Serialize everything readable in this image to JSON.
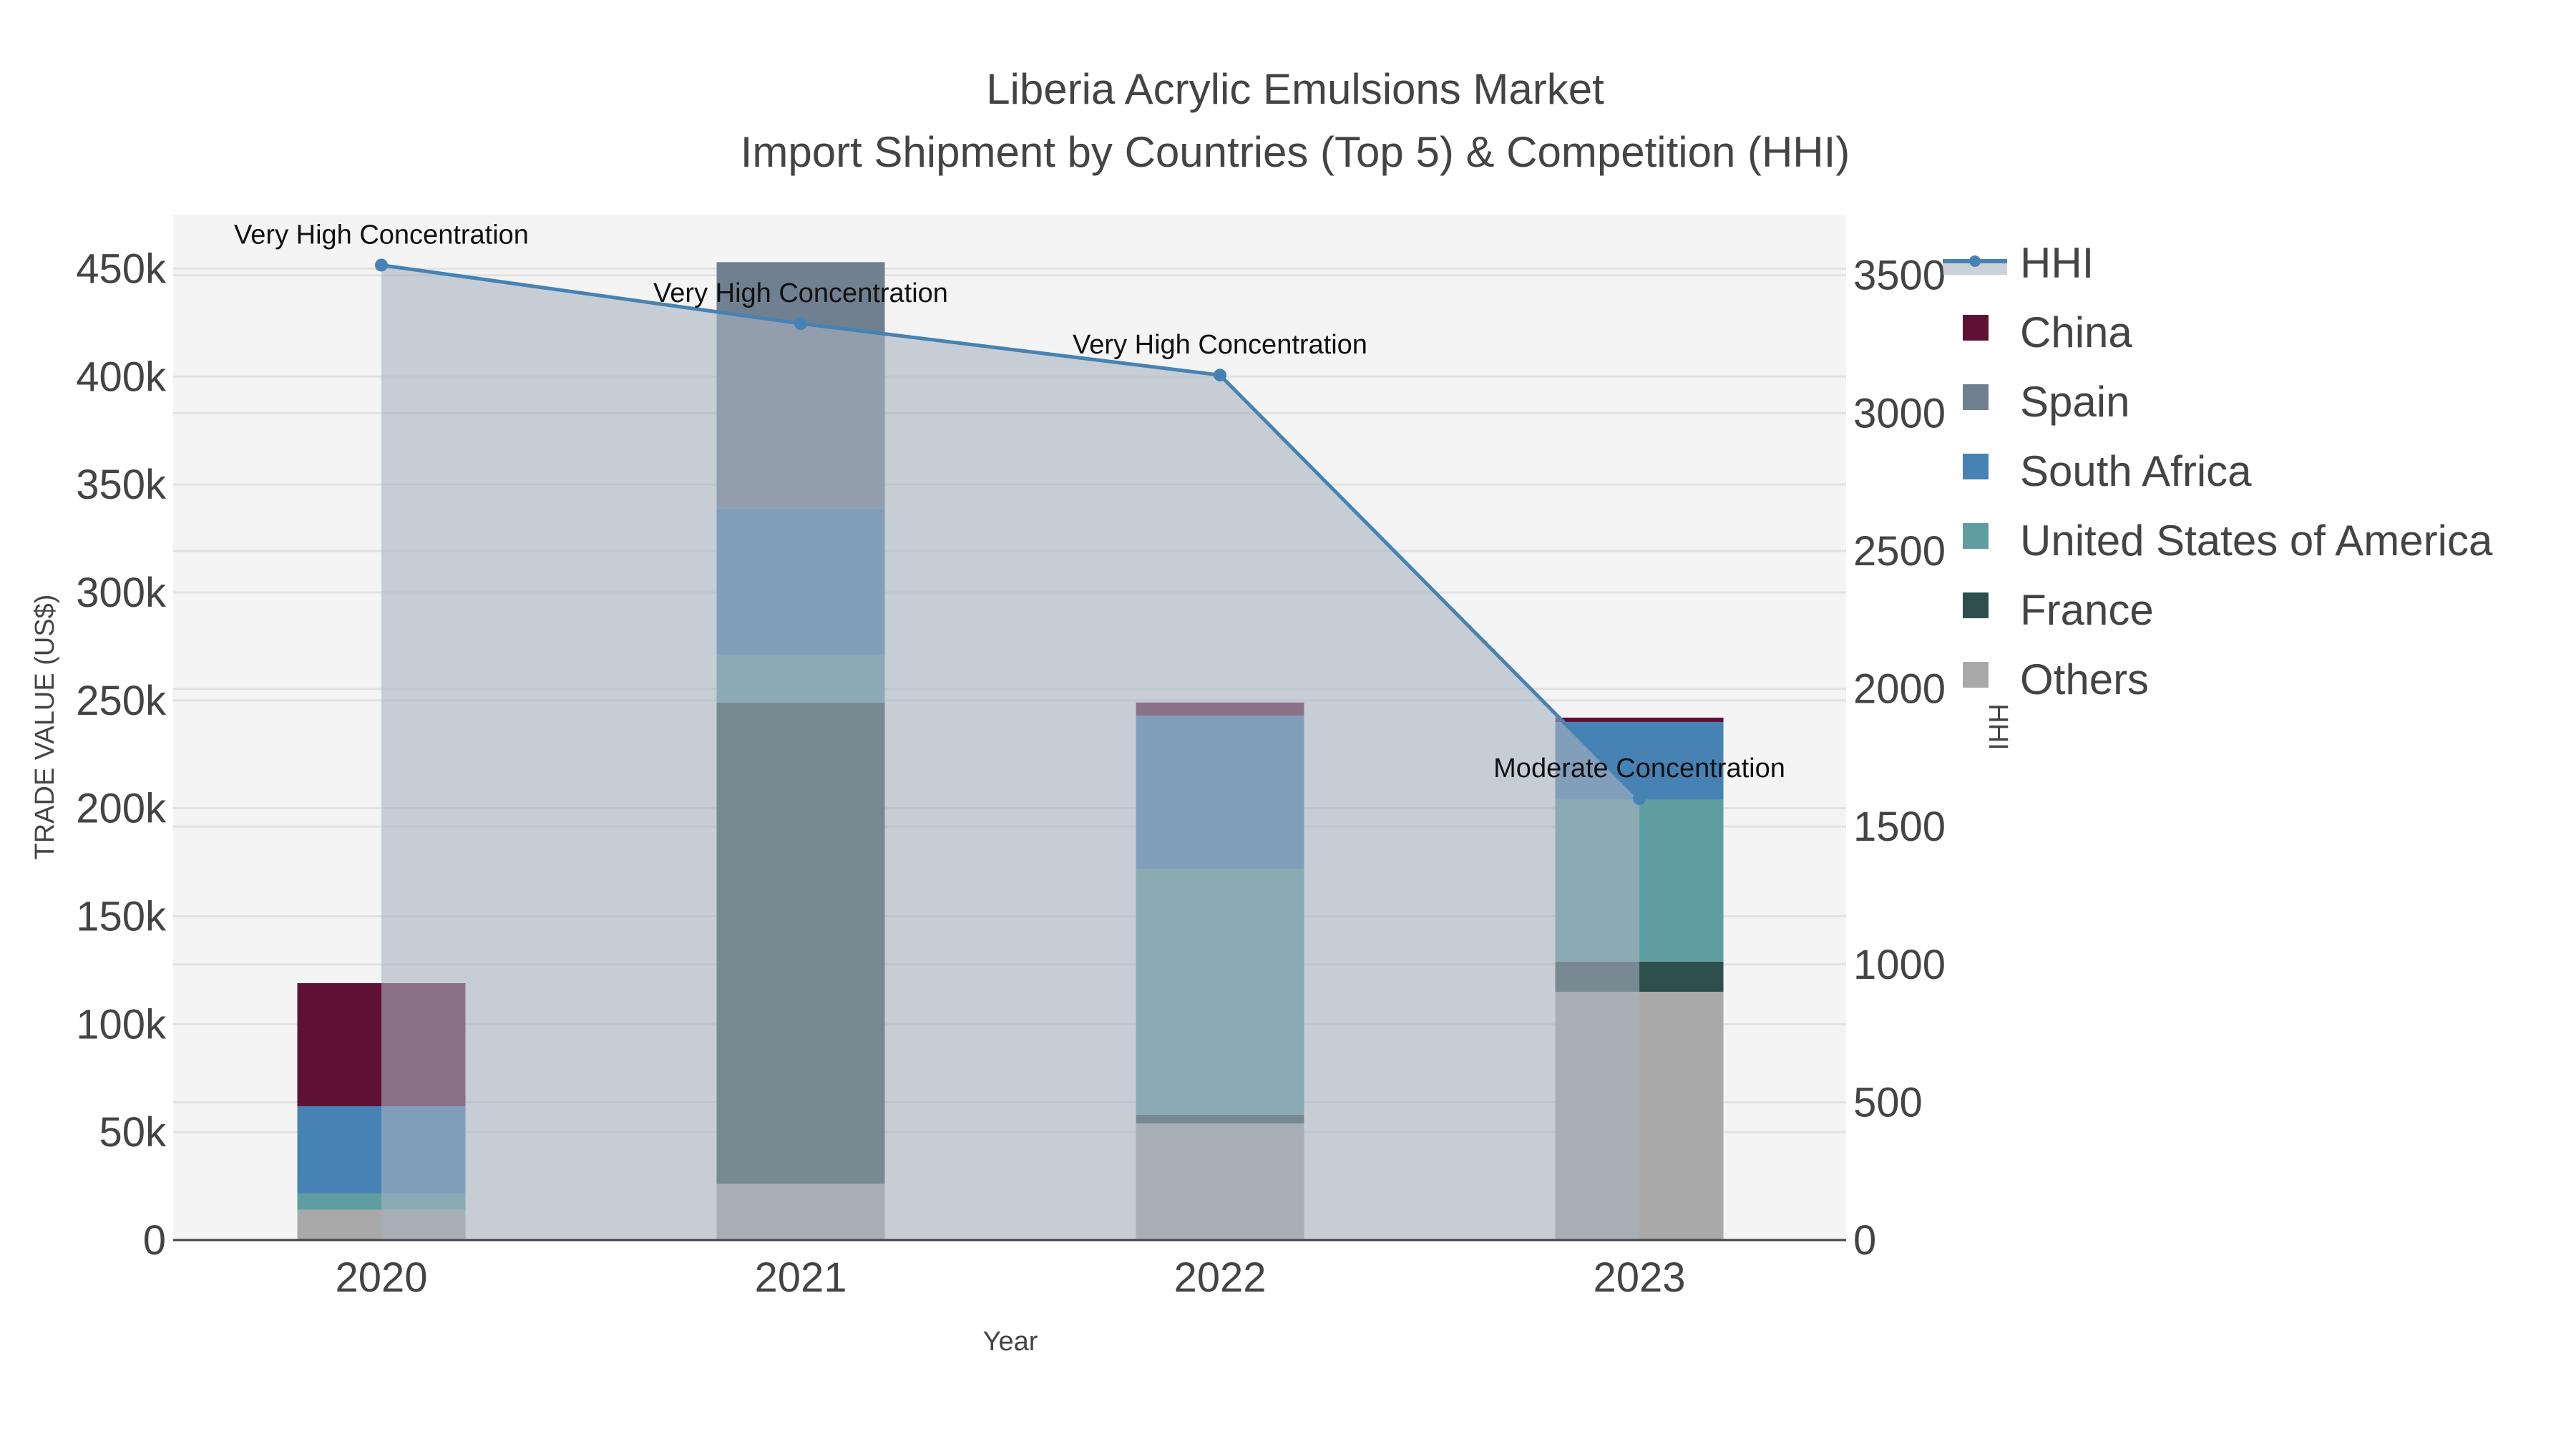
{
  "chart_data": {
    "type": "bar",
    "title": "Liberia Acrylic Emulsions Market",
    "subtitle": "Import Shipment by Countries (Top 5) & Competition (HHI)",
    "xlabel": "Year",
    "ylabel": "TRADE VALUE (US$)",
    "y2label": "HHI",
    "categories": [
      "2020",
      "2021",
      "2022",
      "2023"
    ],
    "ylim": [
      0,
      475000
    ],
    "y2lim": [
      0,
      3720
    ],
    "yticks": [
      0,
      50000,
      100000,
      150000,
      200000,
      250000,
      300000,
      350000,
      400000,
      450000
    ],
    "ytick_labels": [
      "0",
      "50k",
      "100k",
      "150k",
      "200k",
      "250k",
      "300k",
      "350k",
      "400k",
      "450k"
    ],
    "y2ticks": [
      0,
      500,
      1000,
      1500,
      2000,
      2500,
      3000,
      3500
    ],
    "y2tick_labels": [
      "0",
      "500",
      "1000",
      "1500",
      "2000",
      "2500",
      "3000",
      "3500"
    ],
    "grid": true,
    "legend_placement": "right",
    "series": [
      {
        "name": "Others",
        "color": "#a9a9a9",
        "values": [
          14000,
          26000,
          54000,
          115000
        ]
      },
      {
        "name": "France",
        "color": "#2f4f4f",
        "values": [
          0,
          223000,
          4000,
          14000
        ]
      },
      {
        "name": "United States of America",
        "color": "#5f9ea0",
        "values": [
          7500,
          22000,
          114000,
          75000
        ]
      },
      {
        "name": "South Africa",
        "color": "#4682b4",
        "values": [
          40500,
          68000,
          71000,
          36000
        ]
      },
      {
        "name": "Spain",
        "color": "#708090",
        "values": [
          0,
          114000,
          0,
          0
        ]
      },
      {
        "name": "China",
        "color": "#5f1035",
        "values": [
          57000,
          0,
          6000,
          2000
        ]
      }
    ],
    "hhi": {
      "name": "HHI",
      "color": "#4682b4",
      "fill": "#a9b2c0",
      "values": [
        3537,
        3325,
        3138,
        1602
      ],
      "annotations": [
        "Very High Concentration",
        "Very High Concentration",
        "Very High Concentration",
        "Moderate Concentration"
      ]
    },
    "legend_order": [
      "HHI",
      "China",
      "Spain",
      "South Africa",
      "United States of America",
      "France",
      "Others"
    ]
  }
}
